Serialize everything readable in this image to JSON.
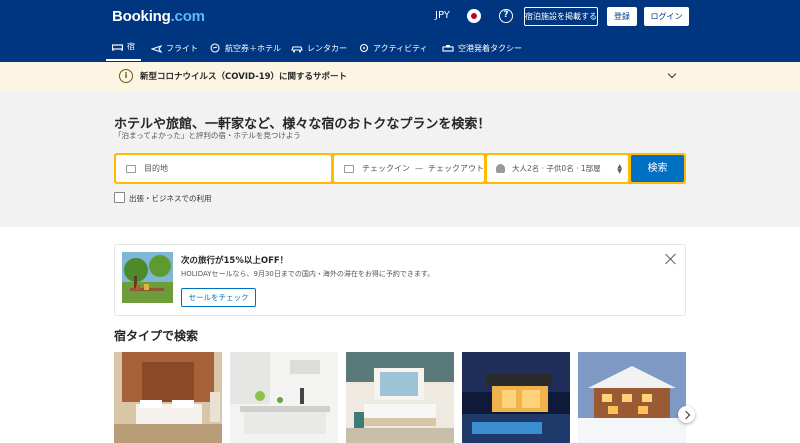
{
  "header": {
    "logo_main": "Booking",
    "logo_dot": ".com",
    "currency": "JPY",
    "help_symbol": "?",
    "list_property": "宿泊施設を掲載する",
    "register": "登録",
    "login": "ログイン"
  },
  "nav": {
    "items": [
      {
        "label": "宿",
        "icon": "bed-icon",
        "active": true
      },
      {
        "label": "フライト",
        "icon": "plane-icon"
      },
      {
        "label": "航空券＋ホテル",
        "icon": "plane-hotel-icon"
      },
      {
        "label": "レンタカー",
        "icon": "car-icon"
      },
      {
        "label": "アクティビティ",
        "icon": "attractions-icon"
      },
      {
        "label": "空港発着タクシー",
        "icon": "taxi-icon"
      }
    ]
  },
  "covid": {
    "icon": "info-icon",
    "text": "新型コロナウイルス（COVID-19）に関するサポート"
  },
  "hero": {
    "title": "ホテルや旅館、一軒家など、様々な宿のおトクなプランを検索！",
    "subtitle": "「泊まってよかった」と評判の宿・ホテルを見つけよう"
  },
  "search": {
    "destination_placeholder": "目的地",
    "checkin": "チェックイン",
    "dash": "—",
    "checkout": "チェックアウト",
    "guests": "大人2名 · 子供0名 · 1部屋",
    "button": "検索",
    "business_checkbox": "出張・ビジネスでの利用"
  },
  "promo": {
    "title": "次の旅行が15%以上OFF！",
    "text": "HOLIDAYセールなら、9月30日までの国内・海外の滞在をお得に予約できます。",
    "button": "セールをチェック"
  },
  "property_types": {
    "title": "宿タイプで検索"
  },
  "colors": {
    "brand_blue": "#003580",
    "search_yellow": "#febb02",
    "action_blue": "#0071c2",
    "covid_bg": "#fdf5e4"
  }
}
